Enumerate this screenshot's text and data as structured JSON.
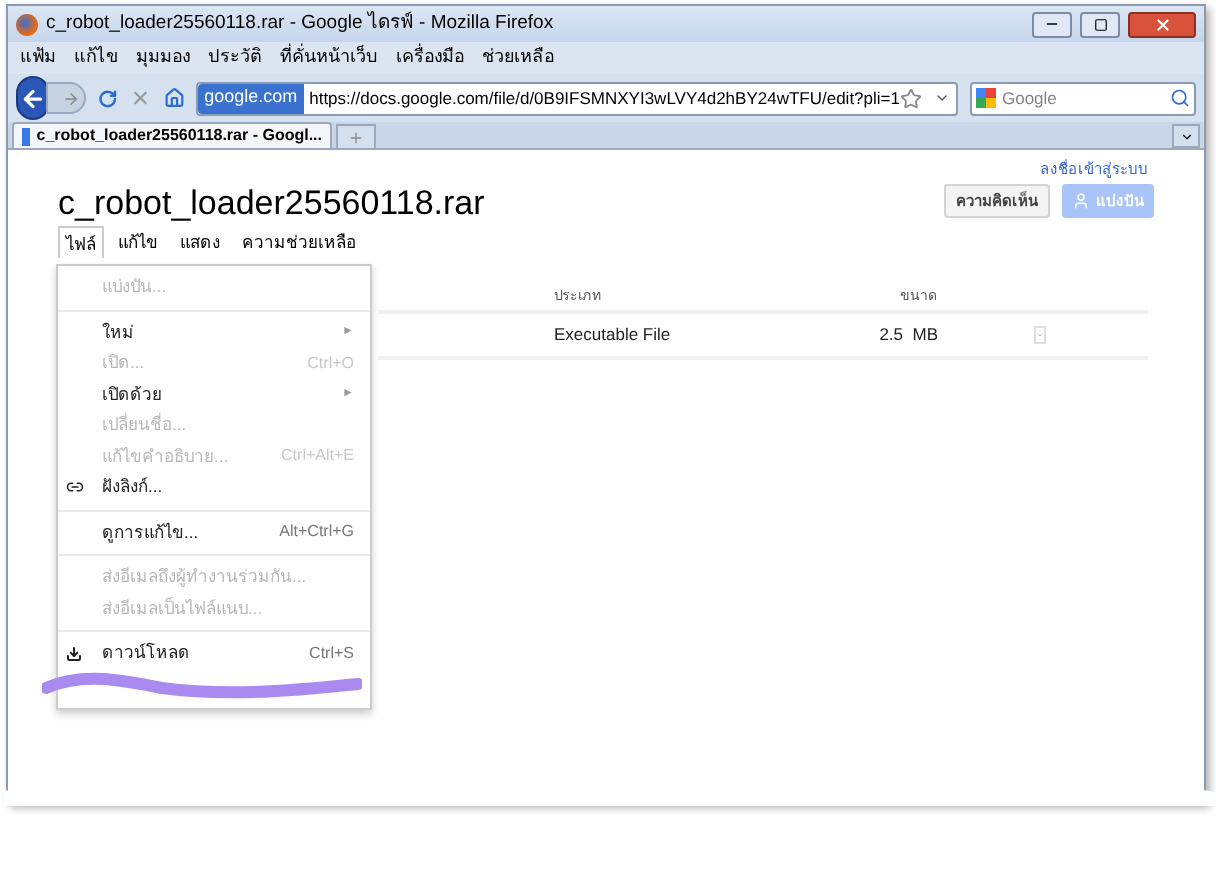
{
  "window": {
    "title": "c_robot_loader25560118.rar - Google ไดรฟ์ - Mozilla Firefox"
  },
  "browser_menu": [
    "แฟ้ม",
    "แก้ไข",
    "มุมมอง",
    "ประวัติ",
    "ที่คั่นหน้าเว็บ",
    "เครื่องมือ",
    "ช่วยเหลือ"
  ],
  "address_bar": {
    "site": "google.com",
    "url": "https://docs.google.com/file/d/0B9IFSMNXYI3wLVY4d2hBY24wTFU/edit?pli=1"
  },
  "search": {
    "placeholder": "Google"
  },
  "tabs": [
    {
      "label": "c_robot_loader25560118.rar - Googl...",
      "selected": true
    }
  ],
  "document": {
    "title": "c_robot_loader25560118.rar",
    "menu": [
      {
        "label": "ไฟล์",
        "selected": true
      },
      {
        "label": "แก้ไข",
        "selected": false
      },
      {
        "label": "แสดง",
        "selected": false
      },
      {
        "label": "ความช่วยเหลือ",
        "selected": false
      }
    ],
    "sign_in": "ลงชื่อเข้าสู่ระบบ",
    "comments_button": "ความคิดเห็น",
    "share_button": {
      "label": "แบ่งปัน",
      "disabled": true
    },
    "table": {
      "columns": [
        "ประเภท",
        "ขนาด"
      ],
      "rows": [
        {
          "type": "Executable File",
          "size": "2.5  MB"
        }
      ]
    }
  },
  "file_menu": [
    {
      "kind": "item",
      "label": "แบ่งปัน...",
      "disabled": true
    },
    {
      "kind": "separator"
    },
    {
      "kind": "item",
      "label": "ใหม่",
      "submenu": "►",
      "disabled": false
    },
    {
      "kind": "item",
      "label": "เปิด...",
      "shortcut": "Ctrl+O",
      "disabled": true
    },
    {
      "kind": "item",
      "label": "เปิดด้วย",
      "submenu": "►",
      "disabled": false
    },
    {
      "kind": "item",
      "label": "เปลี่ยนชื่อ...",
      "disabled": true
    },
    {
      "kind": "item",
      "label": "แก้ไขคำอธิบาย...",
      "shortcut": "Ctrl+Alt+E",
      "disabled": true
    },
    {
      "kind": "link",
      "label": "ฝังลิงก์...",
      "disabled": false
    },
    {
      "kind": "separator"
    },
    {
      "kind": "item",
      "label": "ดูการแก้ไข...",
      "shortcut": "Alt+Ctrl+G",
      "disabled": false
    },
    {
      "kind": "separator"
    },
    {
      "kind": "item",
      "label": "ส่งอีเมลถึงผู้ทำงานร่วมกัน...",
      "disabled": true
    },
    {
      "kind": "item",
      "label": "ส่งอีเมลเป็นไฟล์แนบ...",
      "disabled": true
    },
    {
      "kind": "separator"
    },
    {
      "kind": "download",
      "label": "ดาวน์โหลด",
      "shortcut": "Ctrl+S",
      "disabled": false
    },
    {
      "kind": "scribble"
    }
  ]
}
